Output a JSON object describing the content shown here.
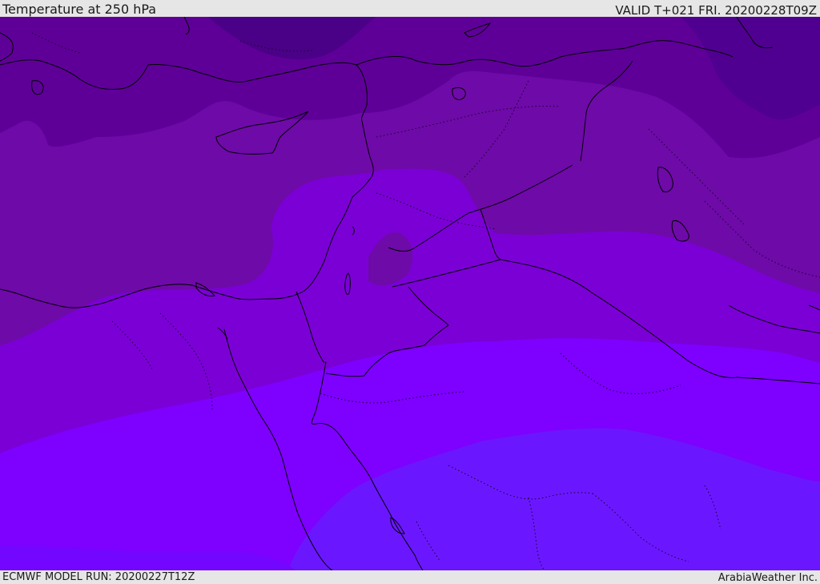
{
  "header": {
    "title": "Temperature at 250 hPa",
    "valid": "VALID T+021 FRI. 20200228T09Z"
  },
  "footer": {
    "model_run": "ECMWF MODEL RUN: 20200227T12Z",
    "credit": "ArabiaWeather Inc."
  },
  "map": {
    "field": "temperature",
    "level": "250 hPa",
    "band_colors": [
      "#4b0088",
      "#5e0098",
      "#6e0aa8",
      "#7b00d6",
      "#7e00ff",
      "#6a17ff"
    ],
    "coastline_color": "#000000",
    "border_style": "dotted"
  }
}
